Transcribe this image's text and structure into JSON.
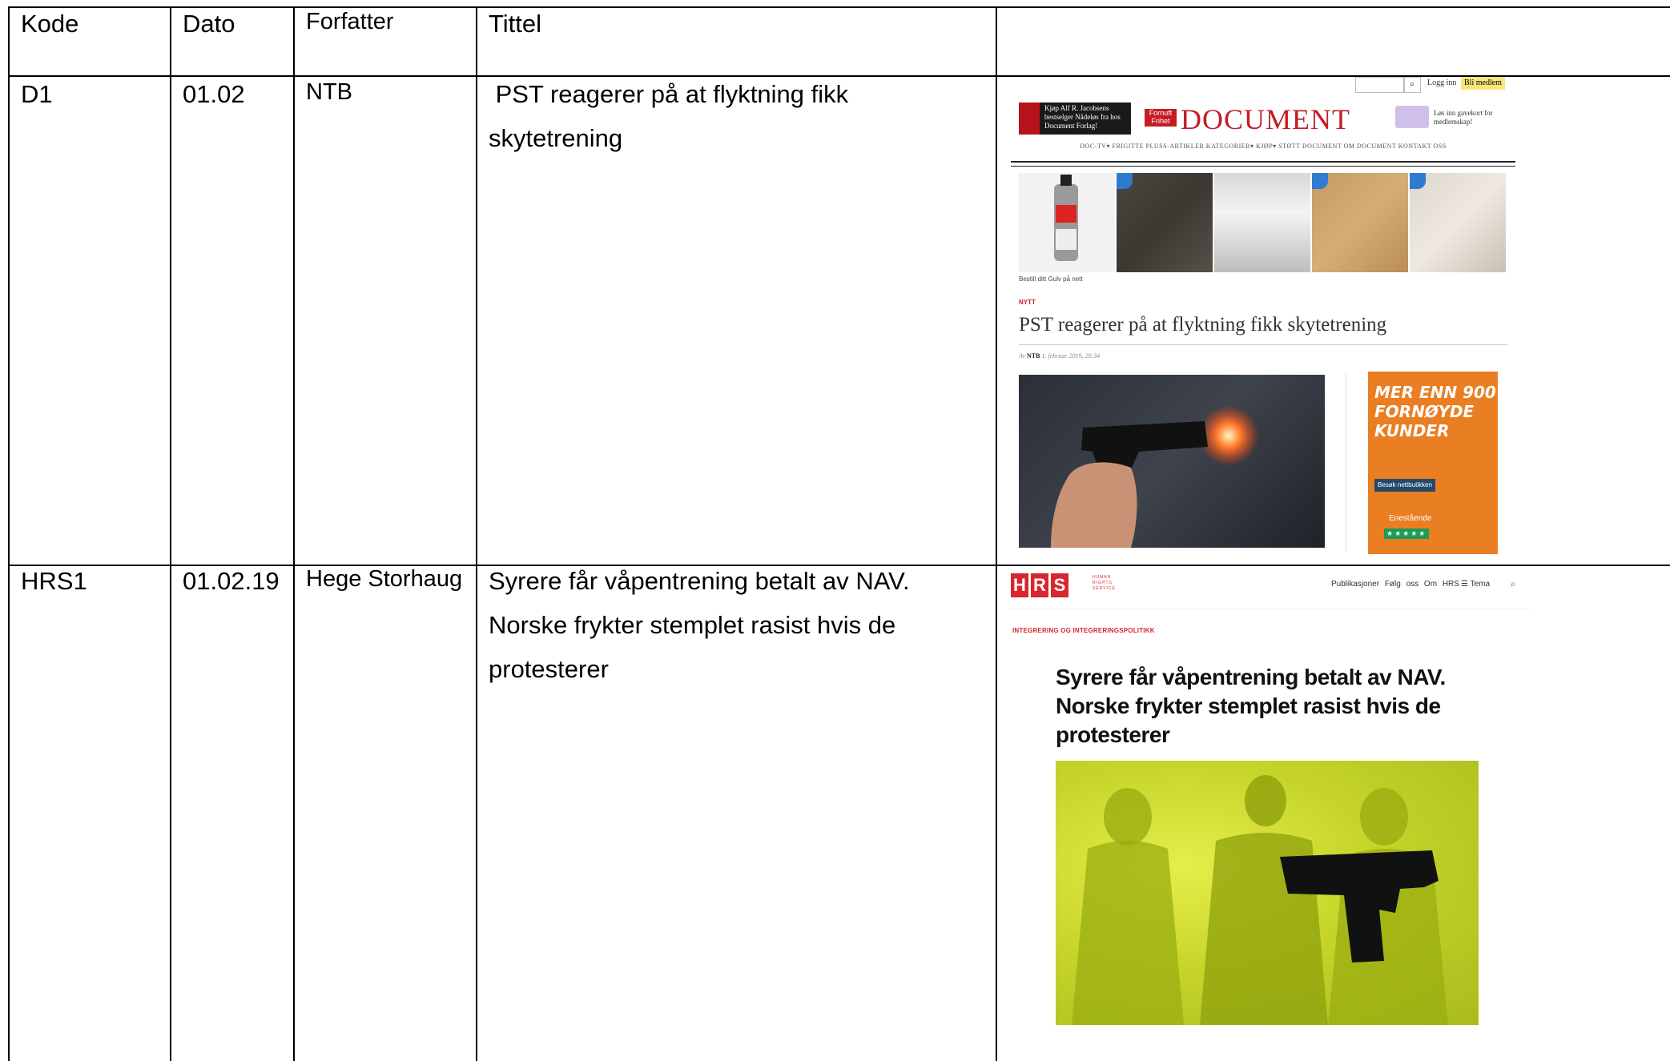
{
  "table": {
    "headers": [
      "Kode",
      "Dato",
      "Forfatter",
      "Tittel",
      ""
    ],
    "rows": [
      {
        "kode": "D1",
        "dato": "01.02",
        "forfatter": "NTB",
        "tittel_lines": [
          " PST reagerer på at flyktning fikk",
          "skytetrening"
        ]
      },
      {
        "kode": "HRS1",
        "dato": "01.02.19",
        "forfatter": "Hege Storhaug",
        "tittel_lines": [
          "Syrere får våpentrening betalt av NAV.",
          "Norske frykter stemplet rasist hvis de",
          "protesterer"
        ]
      }
    ]
  },
  "screenshot_document": {
    "login": "Logg inn",
    "member_button": "Bli medlem",
    "ad_left_text": "Kjøp Alf R. Jacobsens bestselger Nådeløs fra hos Document Forlag!",
    "frihet_badge": "Fornuft Frihet",
    "logo": "DOCUMENT",
    "gift_text": "Løs inn gavekort for medlemskap!",
    "nav": "DOC-TV▾  FRIGITTE PLUSS-ARTIKLER  KATEGORIER▾  KJØP▾  STØTT DOCUMENT  OM DOCUMENT  KONTAKT OSS",
    "ad_bestill": "Bestill ditt Gulv på nett",
    "category": "NYTT",
    "headline": "PST reagerer på at flyktning fikk skytetrening",
    "byline_prefix": "Av",
    "byline_author": "NTB",
    "byline_date": "1. februar 2019, 20:34",
    "ad_right_headline": "MER ENN 900 FORNØYDE KUNDER",
    "ad_right_button": "Besøk nettbutikken",
    "ad_right_small": "Enestående",
    "ad_right_stars": "★★★★★",
    "accent_color": "#c21d25"
  },
  "screenshot_hrs": {
    "logo_letters": [
      "H",
      "R",
      "S"
    ],
    "logo_sub": "HUMAN RIGHTS SERVICE",
    "nav": "Publikasjoner  Følg oss  Om HRS",
    "menu_label": "☰ Tema",
    "category": "INTEGRERING OG INTEGRERINGSPOLITIKK",
    "title": "Syrere får våpentrening betalt av NAV. Norske frykter stemplet rasist hvis de protesterer",
    "accent_color": "#d8262e"
  }
}
